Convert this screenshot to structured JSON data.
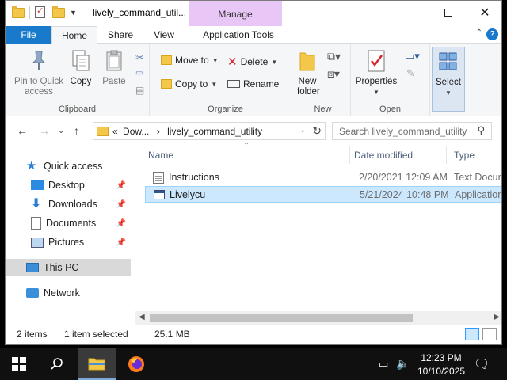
{
  "window": {
    "title": "lively_command_util...",
    "manage_tab": "Manage"
  },
  "ribbon_tabs": {
    "file": "File",
    "home": "Home",
    "share": "Share",
    "view": "View",
    "app_tools": "Application Tools"
  },
  "ribbon": {
    "clipboard": {
      "label": "Clipboard",
      "pin": "Pin to Quick access",
      "copy": "Copy",
      "paste": "Paste"
    },
    "organize": {
      "label": "Organize",
      "move_to": "Move to",
      "copy_to": "Copy to",
      "delete": "Delete",
      "rename": "Rename"
    },
    "new": {
      "label": "New",
      "new_folder": "New folder"
    },
    "open": {
      "label": "Open",
      "properties": "Properties"
    },
    "select": {
      "label": "Select"
    }
  },
  "address": {
    "prefix": "«",
    "crumb1": "Dow...",
    "sep": "›",
    "crumb2": "lively_command_utility"
  },
  "search": {
    "placeholder": "Search lively_command_utility"
  },
  "nav": {
    "quick_access": "Quick access",
    "desktop": "Desktop",
    "downloads": "Downloads",
    "documents": "Documents",
    "pictures": "Pictures",
    "this_pc": "This PC",
    "network": "Network"
  },
  "columns": {
    "name": "Name",
    "date": "Date modified",
    "type": "Type"
  },
  "files": [
    {
      "name": "Instructions",
      "date": "2/20/2021 12:09 AM",
      "type": "Text Document"
    },
    {
      "name": "Livelycu",
      "date": "5/21/2024 10:48 PM",
      "type": "Application"
    }
  ],
  "status": {
    "items": "2 items",
    "selected": "1 item selected",
    "size": "25.1 MB"
  },
  "taskbar": {
    "time": "12:23 PM",
    "date": "10/10/2025"
  },
  "colors": {
    "accent": "#1979ca",
    "manage": "#e8c6f5",
    "selection": "#cce8ff",
    "folder": "#f3c74a"
  }
}
